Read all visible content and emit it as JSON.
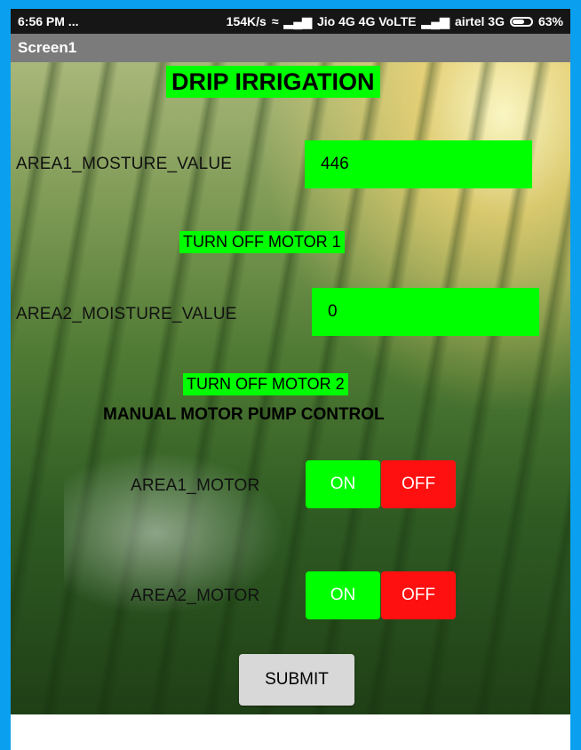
{
  "status_bar": {
    "time": "6:56 PM ...",
    "net_speed": "154K/s",
    "carrier1": "Jio 4G 4G VoLTE",
    "carrier2": "airtel 3G",
    "battery": "63%"
  },
  "app_title": "Screen1",
  "heading": "DRIP IRRIGATION",
  "area1": {
    "label": "AREA1_MOSTURE_VALUE",
    "value": "446",
    "motor_status": "TURN  OFF MOTOR 1"
  },
  "area2": {
    "label": "AREA2_MOISTURE_VALUE",
    "value": "0",
    "motor_status": "TURN OFF MOTOR 2"
  },
  "manual_control": {
    "title": "MANUAL MOTOR PUMP CONTROL",
    "motor1_label": "AREA1_MOTOR",
    "motor2_label": "AREA2_MOTOR",
    "on_label": "ON",
    "off_label": "OFF"
  },
  "submit_label": "SUBMIT",
  "colors": {
    "frame": "#0aa0ef",
    "accent_green": "#00ff00",
    "off_red": "#ff1010",
    "title_bar": "#7b7b7b"
  }
}
